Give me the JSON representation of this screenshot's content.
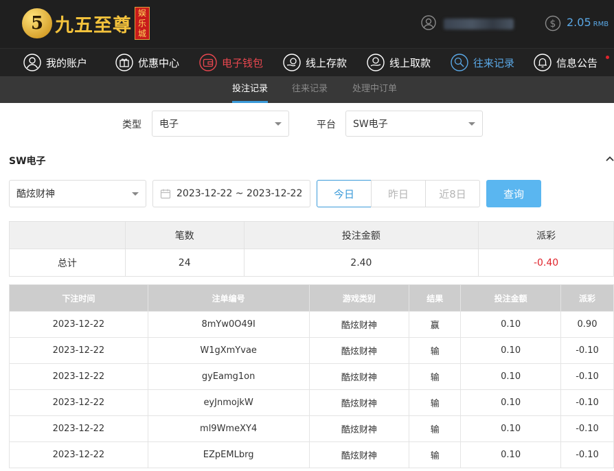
{
  "header": {
    "logo_char": "5",
    "logo_text": "九五至尊",
    "logo_badge": [
      "娱",
      "乐",
      "城"
    ],
    "balance": "2.05",
    "currency": "RMB"
  },
  "nav": {
    "items": [
      {
        "label": "我的账户",
        "icon": "user-icon"
      },
      {
        "label": "优惠中心",
        "icon": "gift-icon"
      },
      {
        "label": "电子钱包",
        "icon": "wallet-icon"
      },
      {
        "label": "线上存款",
        "icon": "deposit-icon"
      },
      {
        "label": "线上取款",
        "icon": "withdraw-icon"
      },
      {
        "label": "往来记录",
        "icon": "records-icon"
      },
      {
        "label": "信息公告",
        "icon": "bell-icon"
      }
    ]
  },
  "subtabs": [
    "投注记录",
    "往来记录",
    "处理中订单"
  ],
  "filters": {
    "type_label": "类型",
    "type_value": "电子",
    "platform_label": "平台",
    "platform_value": "SW电子"
  },
  "section_title": "SW电子",
  "query": {
    "game": "酷炫财神",
    "date_range": "2023-12-22 ~ 2023-12-22",
    "ranges": [
      "今日",
      "昨日",
      "近8日"
    ],
    "search_label": "查询"
  },
  "summary": {
    "headers": [
      "",
      "笔数",
      "投注金额",
      "派彩"
    ],
    "row": [
      "总计",
      "24",
      "2.40",
      "-0.40"
    ]
  },
  "table": {
    "headers": [
      "下注时间",
      "注单编号",
      "游戏类别",
      "结果",
      "投注金额",
      "派彩"
    ],
    "rows": [
      [
        "2023-12-22",
        "8mYw0O49I",
        "酷炫财神",
        "赢",
        "0.10",
        "0.90"
      ],
      [
        "2023-12-22",
        "W1gXmYvae",
        "酷炫财神",
        "输",
        "0.10",
        "-0.10"
      ],
      [
        "2023-12-22",
        "gyEamg1on",
        "酷炫财神",
        "输",
        "0.10",
        "-0.10"
      ],
      [
        "2023-12-22",
        "eyJnmojkW",
        "酷炫财神",
        "输",
        "0.10",
        "-0.10"
      ],
      [
        "2023-12-22",
        "ml9WmeXY4",
        "酷炫财神",
        "输",
        "0.10",
        "-0.10"
      ],
      [
        "2023-12-22",
        "EZpEMLbrg",
        "酷炫财神",
        "输",
        "0.10",
        "-0.10"
      ]
    ]
  },
  "colors": {
    "accent": "#3a9ad9",
    "active_nav": "#e8474f",
    "negative": "#e0242c",
    "gold": "#f3c23c"
  }
}
